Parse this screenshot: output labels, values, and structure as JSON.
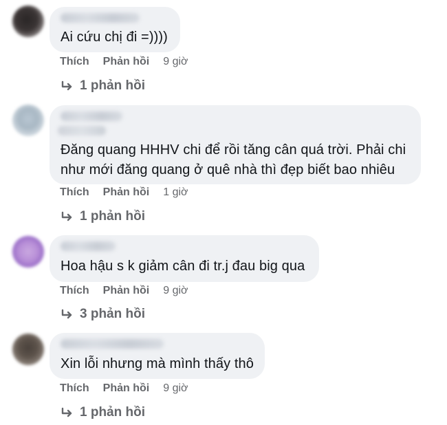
{
  "colors": {
    "bubble_bg": "#eff1f4",
    "text": "#111418",
    "secondary_text": "#65676b"
  },
  "comments": [
    {
      "text_lines": [
        "Ai cứu chị đi =))))"
      ],
      "like_label": "Thích",
      "reply_label": "Phản hồi",
      "time": "9 giờ",
      "replies_label": "1 phản hồi",
      "avatar_icon": "blurred-avatar-dark"
    },
    {
      "text_lines": [
        "Đăng quang HHHV chi để rồi tăng cân quá trời. Phải chi",
        "như mới đăng quang ở quê nhà thì đẹp biết bao nhiêu"
      ],
      "like_label": "Thích",
      "reply_label": "Phản hồi",
      "time": "1 giờ",
      "replies_label": "1 phản hồi",
      "avatar_icon": "blurred-avatar-light"
    },
    {
      "text_lines": [
        "Hoa hậu s k giảm cân đi tr.j đau big qua"
      ],
      "like_label": "Thích",
      "reply_label": "Phản hồi",
      "time": "9 giờ",
      "replies_label": "3 phản hồi",
      "avatar_icon": "blurred-avatar-purple"
    },
    {
      "text_lines": [
        "Xin lỗi nhưng mà mình thấy thô"
      ],
      "like_label": "Thích",
      "reply_label": "Phản hồi",
      "time": "9 giờ",
      "replies_label": "1 phản hồi",
      "avatar_icon": "blurred-avatar-brown"
    }
  ]
}
